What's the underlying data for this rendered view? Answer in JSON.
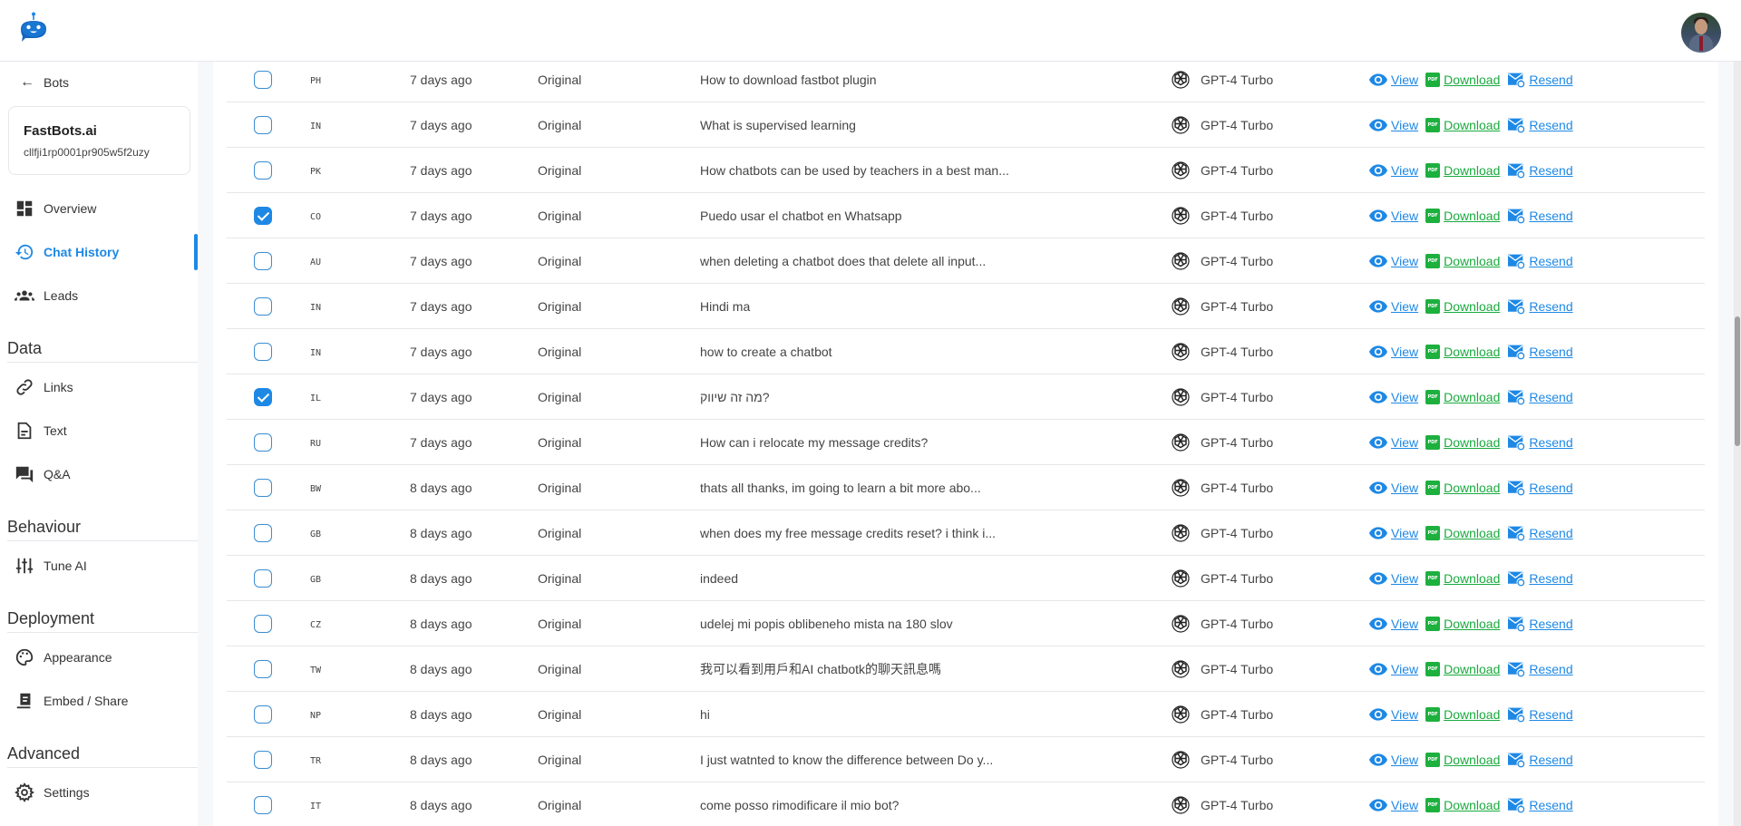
{
  "header": {
    "logo": "fastbots-robot-logo",
    "avatar": "user-avatar"
  },
  "sidebar": {
    "back_label": "Bots",
    "bot": {
      "name": "FastBots.ai",
      "id": "cllfji1rp0001pr905w5f2uzy"
    },
    "main_items": [
      {
        "label": "Overview",
        "icon": "dashboard-icon"
      },
      {
        "label": "Chat History",
        "icon": "history-icon",
        "active": true
      },
      {
        "label": "Leads",
        "icon": "people-icon"
      }
    ],
    "sections": [
      {
        "title": "Data",
        "items": [
          {
            "label": "Links",
            "icon": "link-icon"
          },
          {
            "label": "Text",
            "icon": "document-icon"
          },
          {
            "label": "Q&A",
            "icon": "chat-bubbles-icon"
          }
        ]
      },
      {
        "title": "Behaviour",
        "items": [
          {
            "label": "Tune AI",
            "icon": "sliders-icon"
          }
        ]
      },
      {
        "title": "Deployment",
        "items": [
          {
            "label": "Appearance",
            "icon": "palette-icon"
          },
          {
            "label": "Embed / Share",
            "icon": "embed-icon"
          }
        ]
      },
      {
        "title": "Advanced",
        "items": [
          {
            "label": "Settings",
            "icon": "gear-icon"
          }
        ]
      }
    ]
  },
  "table": {
    "actions": {
      "view": "View",
      "download": "Download",
      "resend": "Resend"
    },
    "rows": [
      {
        "checked": false,
        "country": "PH",
        "time": "7 days ago",
        "type": "Original",
        "message": "How to download fastbot plugin",
        "model": "GPT-4 Turbo"
      },
      {
        "checked": false,
        "country": "IN",
        "time": "7 days ago",
        "type": "Original",
        "message": "What is supervised learning",
        "model": "GPT-4 Turbo"
      },
      {
        "checked": false,
        "country": "PK",
        "time": "7 days ago",
        "type": "Original",
        "message": "How chatbots can be used by teachers in a best man...",
        "model": "GPT-4 Turbo"
      },
      {
        "checked": true,
        "country": "CO",
        "time": "7 days ago",
        "type": "Original",
        "message": "Puedo usar el chatbot en Whatsapp",
        "model": "GPT-4 Turbo"
      },
      {
        "checked": false,
        "country": "AU",
        "time": "7 days ago",
        "type": "Original",
        "message": "when deleting a chatbot does that delete all input...",
        "model": "GPT-4 Turbo"
      },
      {
        "checked": false,
        "country": "IN",
        "time": "7 days ago",
        "type": "Original",
        "message": "Hindi ma",
        "model": "GPT-4 Turbo"
      },
      {
        "checked": false,
        "country": "IN",
        "time": "7 days ago",
        "type": "Original",
        "message": "how to create a chatbot",
        "model": "GPT-4 Turbo"
      },
      {
        "checked": true,
        "country": "IL",
        "time": "7 days ago",
        "type": "Original",
        "message": "מה זה שיווק?",
        "model": "GPT-4 Turbo"
      },
      {
        "checked": false,
        "country": "RU",
        "time": "7 days ago",
        "type": "Original",
        "message": "How can i relocate my message credits?",
        "model": "GPT-4 Turbo"
      },
      {
        "checked": false,
        "country": "BW",
        "time": "8 days ago",
        "type": "Original",
        "message": "thats all thanks, im going to learn a bit more abo...",
        "model": "GPT-4 Turbo"
      },
      {
        "checked": false,
        "country": "GB",
        "time": "8 days ago",
        "type": "Original",
        "message": "when does my free message credits reset? i think i...",
        "model": "GPT-4 Turbo"
      },
      {
        "checked": false,
        "country": "GB",
        "time": "8 days ago",
        "type": "Original",
        "message": "indeed",
        "model": "GPT-4 Turbo"
      },
      {
        "checked": false,
        "country": "CZ",
        "time": "8 days ago",
        "type": "Original",
        "message": "udelej mi popis oblibeneho mista na 180 slov",
        "model": "GPT-4 Turbo"
      },
      {
        "checked": false,
        "country": "TW",
        "time": "8 days ago",
        "type": "Original",
        "message": "我可以看到用戶和AI chatbotk的聊天訊息嗎",
        "model": "GPT-4 Turbo"
      },
      {
        "checked": false,
        "country": "NP",
        "time": "8 days ago",
        "type": "Original",
        "message": "hi",
        "model": "GPT-4 Turbo"
      },
      {
        "checked": false,
        "country": "TR",
        "time": "8 days ago",
        "type": "Original",
        "message": "I just watnted to know the difference between Do y...",
        "model": "GPT-4 Turbo"
      },
      {
        "checked": false,
        "country": "IT",
        "time": "8 days ago",
        "type": "Original",
        "message": "come posso rimodificare il mio bot?",
        "model": "GPT-4 Turbo"
      }
    ]
  },
  "colors": {
    "accent": "#1e88e5",
    "download": "#1aaa3e"
  }
}
